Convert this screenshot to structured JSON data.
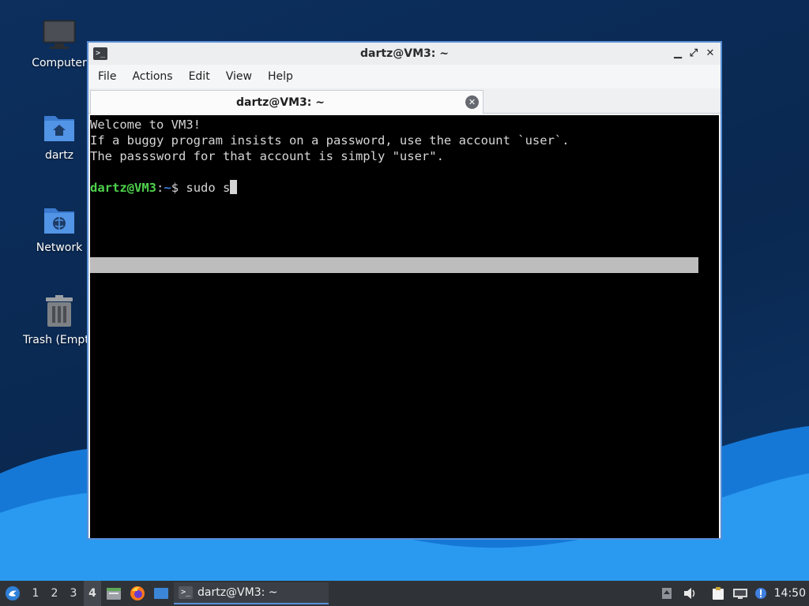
{
  "desktop": {
    "icons": [
      {
        "label": "Computer",
        "icon": "computer-icon"
      },
      {
        "label": "dartz",
        "icon": "home-folder-icon"
      },
      {
        "label": "Network",
        "icon": "network-folder-icon"
      },
      {
        "label": "Trash (Empt",
        "icon": "trash-icon"
      }
    ],
    "colors": {
      "background": "#0b2a56",
      "wave": "#1a8fe6"
    }
  },
  "window": {
    "title": "dartz@VM3: ~",
    "controls": {
      "minimize": "▁",
      "maximize": "⤢",
      "close": "✕"
    },
    "menu": [
      "File",
      "Actions",
      "Edit",
      "View",
      "Help"
    ],
    "tab": {
      "label": "dartz@VM3: ~",
      "close_icon": "close-circle-icon"
    },
    "accent": "#5a8fd6"
  },
  "terminal": {
    "lines": [
      "Welcome to VM3!",
      "If a buggy program insists on a password, use the account `user`.",
      "The passsword for that account is simply \"user\"."
    ],
    "prompt_user": "dartz@VM3",
    "prompt_sep": ":",
    "prompt_path": "~",
    "prompt_symbol": "$ ",
    "command": "sudo s",
    "colors": {
      "bg": "#000000",
      "text": "#d6d6d6",
      "user": "#4fd24c",
      "path": "#3f7fe0"
    }
  },
  "taskbar": {
    "start_icon": "start-menu-icon",
    "workspaces": [
      "1",
      "2",
      "3",
      "4"
    ],
    "active_workspace": "4",
    "launchers": [
      "file-manager-icon",
      "firefox-icon",
      "show-desktop-icon"
    ],
    "task": {
      "label": "dartz@VM3: ~",
      "icon": "terminal-icon"
    },
    "tray": [
      "updates-icon",
      "volume-icon",
      "clipboard-icon",
      "network-icon",
      "notification-icon"
    ],
    "clock": "14:50"
  }
}
